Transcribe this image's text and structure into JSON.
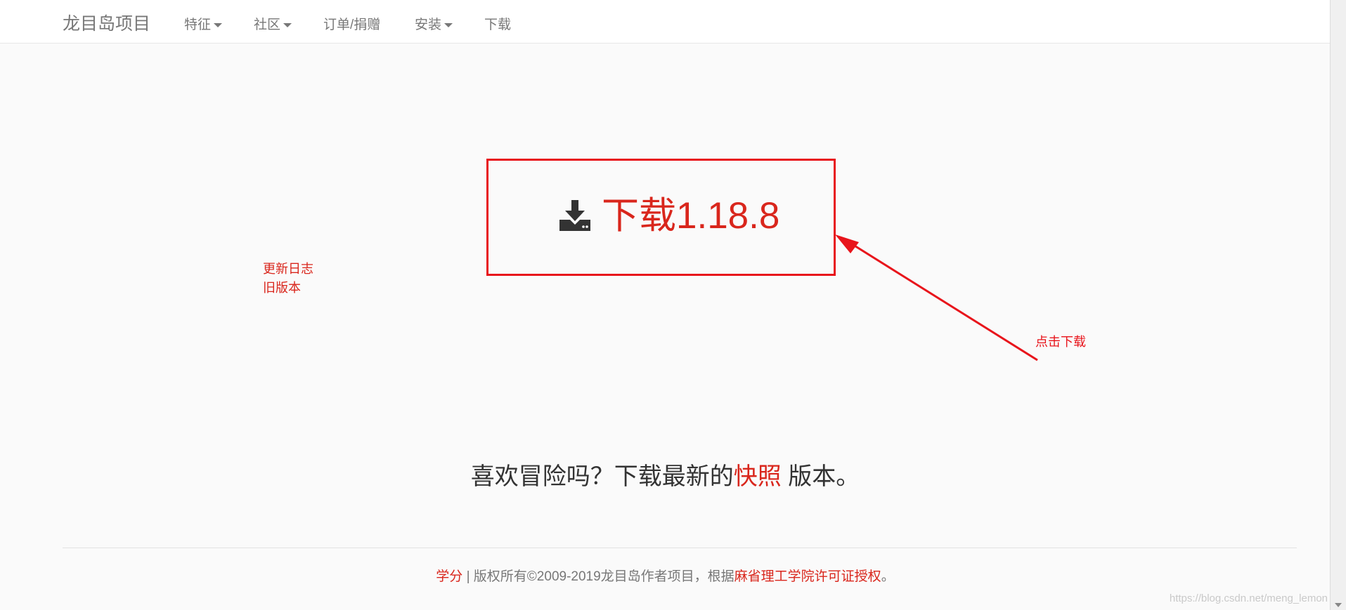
{
  "navbar": {
    "brand": "龙目岛项目",
    "items": [
      {
        "label": "特征",
        "dropdown": true
      },
      {
        "label": "社区",
        "dropdown": true
      },
      {
        "label": "订单/捐赠",
        "dropdown": false
      },
      {
        "label": "安装",
        "dropdown": true
      },
      {
        "label": "下载",
        "dropdown": false
      }
    ]
  },
  "main": {
    "download_label": "下载1.18.8",
    "download_icon": "download-icon",
    "side_links": [
      "更新日志",
      "旧版本"
    ],
    "tagline_prefix": "喜欢冒险吗？下载最新的",
    "tagline_link": "快照",
    "tagline_suffix": " 版本。"
  },
  "annotation": {
    "text": "点击下载",
    "color": "#e8141b"
  },
  "footer": {
    "link1": "学分",
    "sep": " | 版权所有©2009-2019龙目岛作者项目，根据",
    "link2": "麻省理工学院许可证授权",
    "end": "。"
  },
  "watermark": "https://blog.csdn.net/meng_lemon",
  "colors": {
    "accent": "#d9261c",
    "annotation": "#e8141b",
    "nav_text": "#777777"
  }
}
